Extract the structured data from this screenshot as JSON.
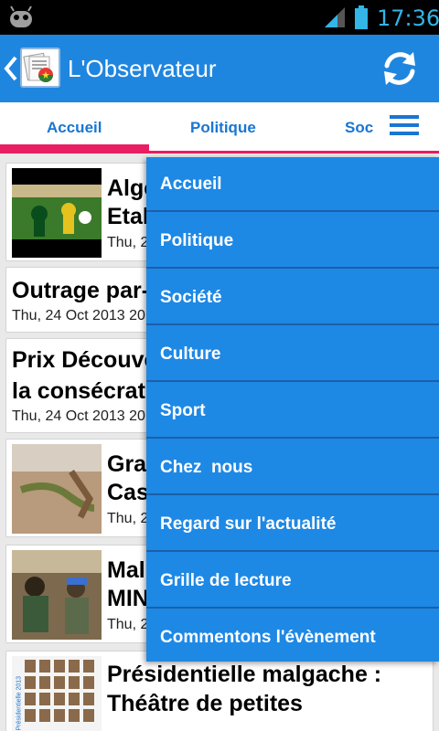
{
  "status_bar": {
    "time": "17:36"
  },
  "app": {
    "title": "L'Observateur"
  },
  "tabs": [
    {
      "label": "Accueil"
    },
    {
      "label": "Politique"
    },
    {
      "label": "Soc"
    }
  ],
  "articles": [
    {
      "title": "Alge",
      "title2": "Etal",
      "date": "Thu, 2"
    },
    {
      "title": "Outrage par-",
      "date": "Thu, 24 Oct 2013 20"
    },
    {
      "title": "Prix Découve",
      "title2": "la consécrati",
      "date": "Thu, 24 Oct 2013 20"
    },
    {
      "title": "Gra",
      "title2": "Cas",
      "date": "Thu, 2"
    },
    {
      "title": "Mal",
      "title2": "MIN",
      "date": "Thu, 2"
    },
    {
      "title": "Présidentielle malgache :",
      "title2": "Théâtre de petites",
      "thumb_caption": "Présidentielle 2013"
    }
  ],
  "menu": [
    {
      "label": "Accueil"
    },
    {
      "label": "Politique"
    },
    {
      "label": "Société"
    },
    {
      "label": "Culture"
    },
    {
      "label": "Sport"
    },
    {
      "label": "Chez  nous"
    },
    {
      "label": "Regard sur l'actualité"
    },
    {
      "label": "Grille de lecture"
    },
    {
      "label": "Commentons l'évènement"
    }
  ],
  "colors": {
    "action_bar": "#1f86df",
    "accent_pink": "#e91e63",
    "menu_bg": "#1e88e5",
    "status_icons": "#33b5e5"
  }
}
